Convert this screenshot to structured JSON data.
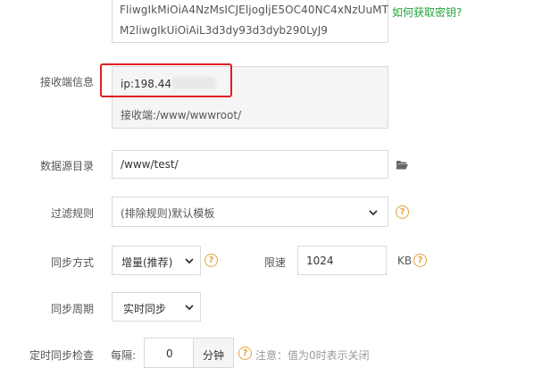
{
  "secret_key": {
    "line1": "FliwgIkMiOiA4NzMsICJEljogljE5OC40NC4xNzUuMT",
    "line2": "M2liwgIkUiOiAiL3d3dy93d3dyb290LyJ9",
    "help_link": "如何获取密钥?"
  },
  "receiver": {
    "label": "接收端信息",
    "ip_text": "ip:198.44",
    "path_text": "接收端:/www/wwwroot/"
  },
  "datasource": {
    "label": "数据源目录",
    "value": "/www/test/",
    "icon": "folder-open-icon"
  },
  "filter": {
    "label": "过滤规则",
    "selected": "(排除规则)默认模板"
  },
  "sync_mode": {
    "label": "同步方式",
    "selected": "增量(推荐)",
    "limit_label": "限速",
    "limit_value": "1024",
    "unit": "KB"
  },
  "sync_cycle": {
    "label": "同步周期",
    "selected": "实时同步"
  },
  "periodic_check": {
    "label": "定时同步检查",
    "every_label": "每隔:",
    "value": "0",
    "unit": "分钟",
    "note": "注意：值为0时表示关闭"
  },
  "colors": {
    "accent_green": "#20a53a",
    "help_orange": "#e6a23c",
    "highlight_red": "#e02020"
  }
}
